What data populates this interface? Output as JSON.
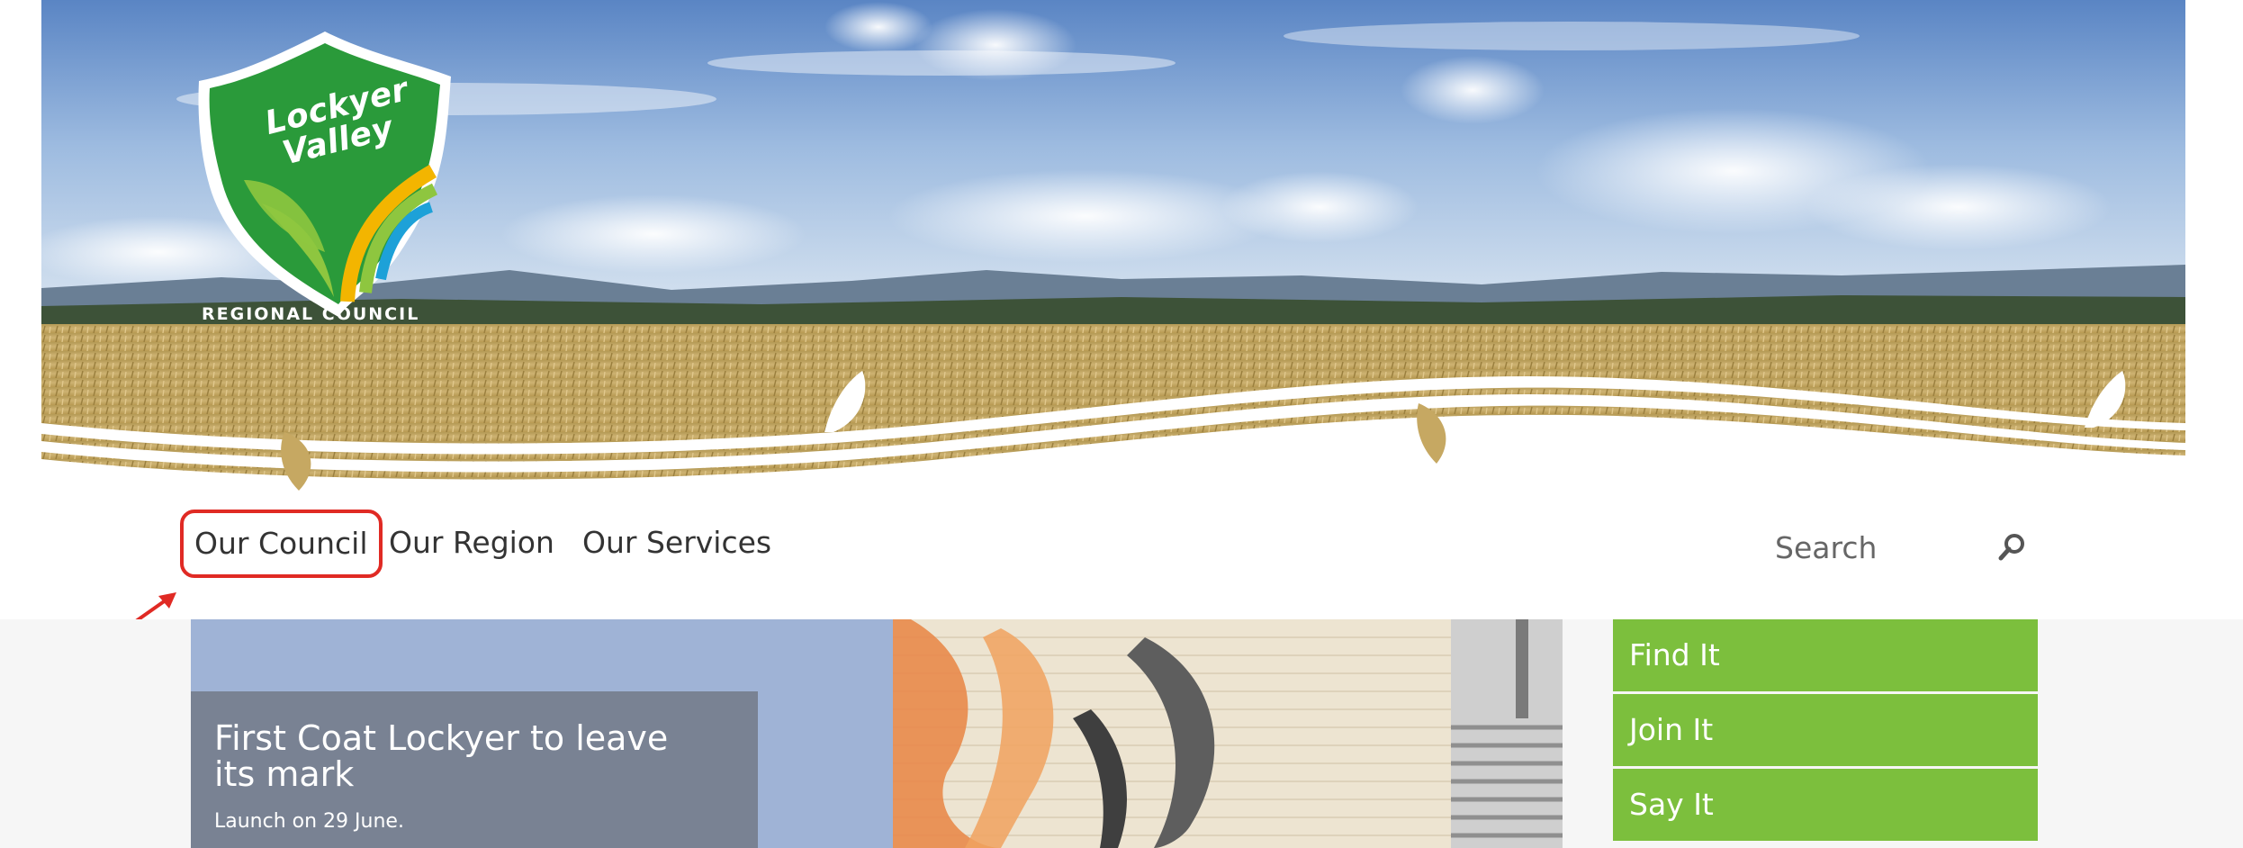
{
  "logo": {
    "line1": "Lockyer",
    "line2": "Valley",
    "caption": "REGIONAL COUNCIL"
  },
  "nav": {
    "items": [
      {
        "label": "Our Council"
      },
      {
        "label": "Our Region"
      },
      {
        "label": "Our Services"
      }
    ]
  },
  "search": {
    "placeholder": "Search",
    "icon": "search-icon"
  },
  "hero": {
    "title": "First Coat Lockyer to leave its mark",
    "subtitle": "Launch on 29 June."
  },
  "quick_links": [
    {
      "label": "Find It"
    },
    {
      "label": "Join It"
    },
    {
      "label": "Say It"
    }
  ],
  "colors": {
    "accent_green": "#7cbf3d",
    "highlight_red": "#e02a24",
    "logo_green": "#2a9a3a"
  }
}
